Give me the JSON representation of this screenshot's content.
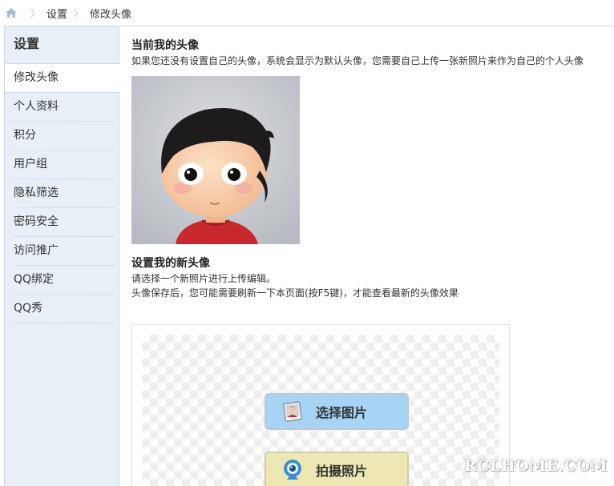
{
  "breadcrumb": {
    "items": [
      "设置",
      "修改头像"
    ]
  },
  "sidebar": {
    "title": "设置",
    "items": [
      {
        "label": "修改头像",
        "active": true
      },
      {
        "label": "个人资料"
      },
      {
        "label": "积分"
      },
      {
        "label": "用户组"
      },
      {
        "label": "隐私筛选"
      },
      {
        "label": "密码安全"
      },
      {
        "label": "访问推广"
      },
      {
        "label": "QQ绑定"
      },
      {
        "label": "QQ秀"
      }
    ]
  },
  "current_avatar": {
    "title": "当前我的头像",
    "desc": "如果您还没有设置自己的头像，系统会显示为默认头像，您需要自己上传一张新照片来作为自己的个人头像"
  },
  "new_avatar": {
    "title": "设置我的新头像",
    "desc1": "请选择一个新照片进行上传编辑。",
    "desc2": "头像保存后，您可能需要刷新一下本页面(按F5键)，才能查看最新的头像效果"
  },
  "upload": {
    "select_label": "选择图片",
    "shoot_label": "拍摄照片"
  },
  "watermark": "RCLHOME.COM",
  "colors": {
    "sidebar_bg": "#e8eff7",
    "select_button": "#a7d3f5",
    "shoot_button": "#ede7b4"
  }
}
